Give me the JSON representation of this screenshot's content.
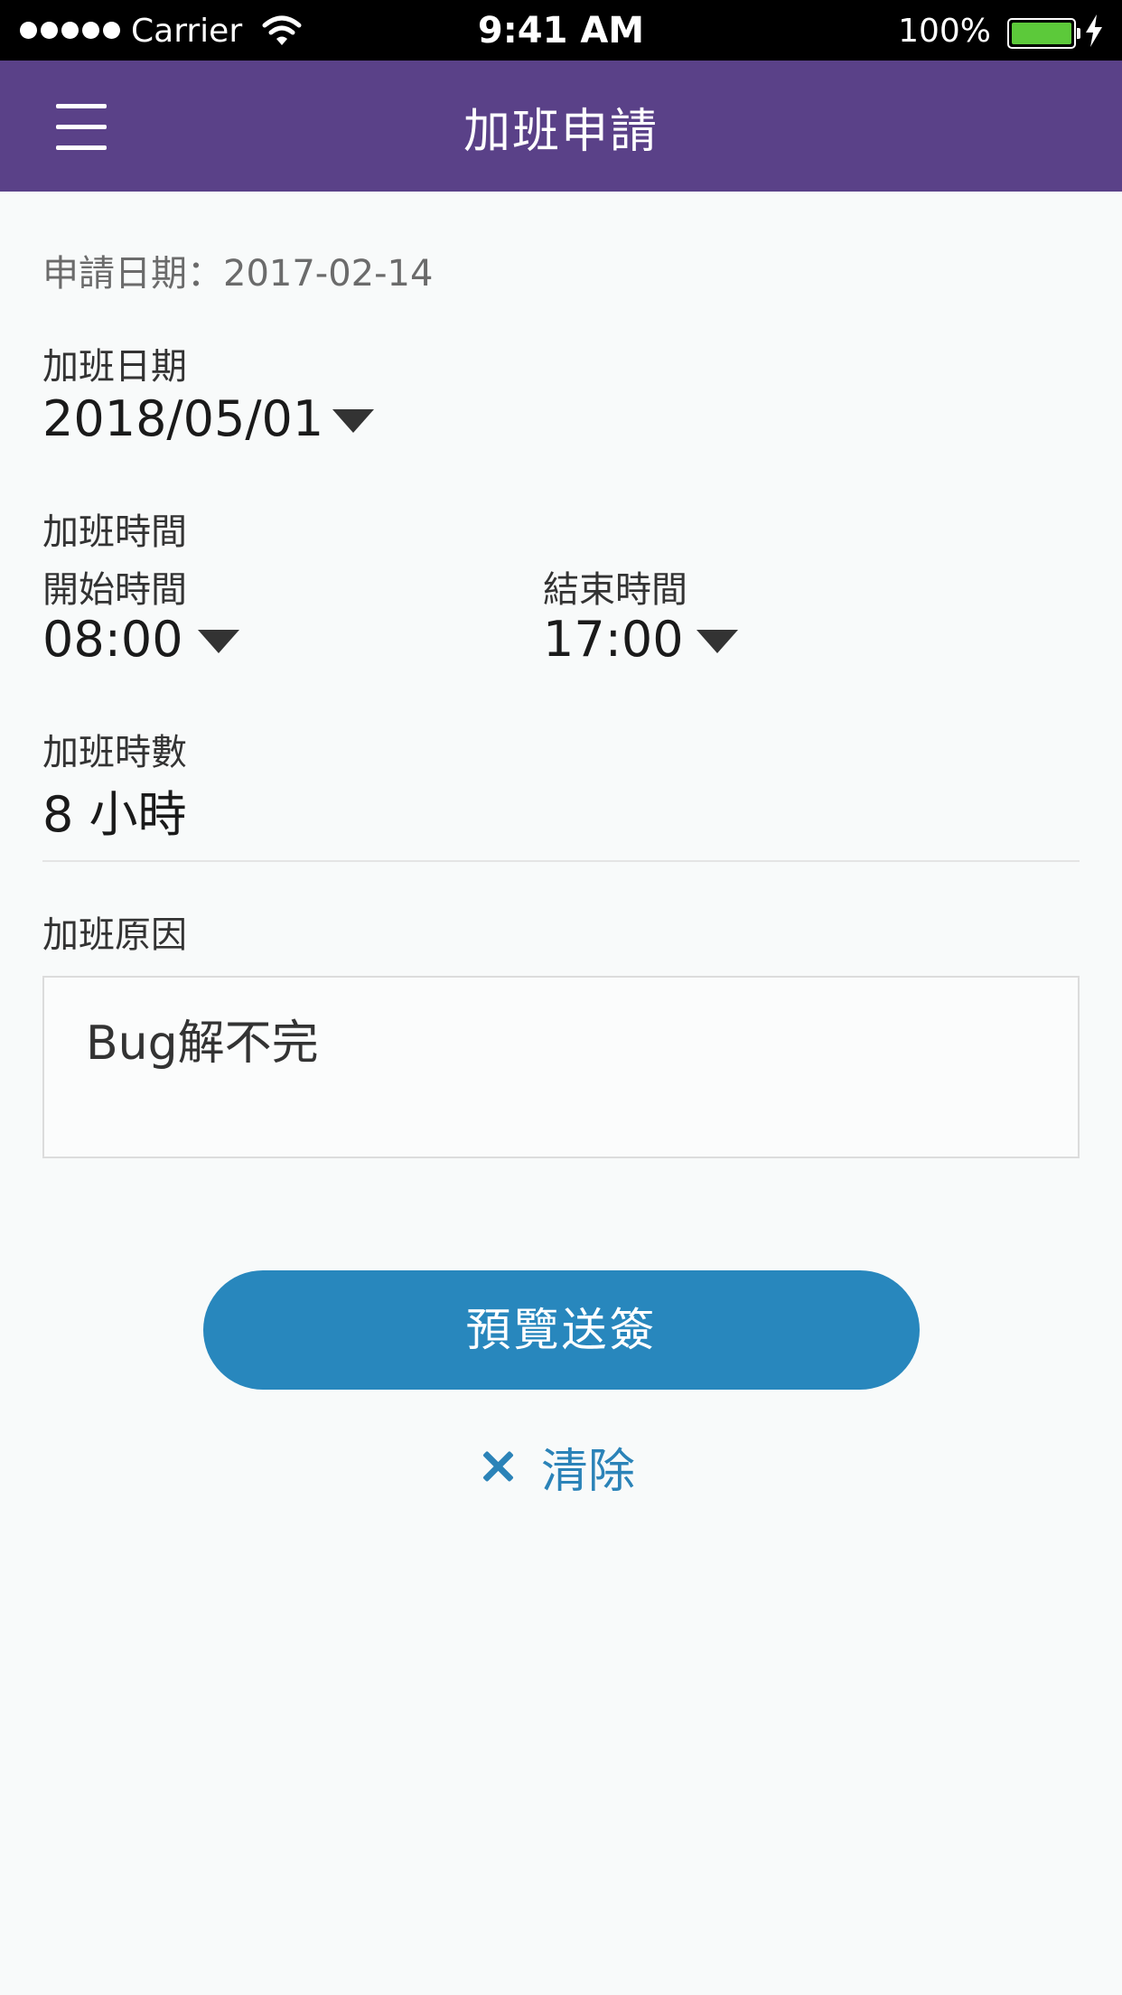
{
  "status_bar": {
    "carrier": "Carrier",
    "time": "9:41 AM",
    "battery": "100%",
    "battery_level": 1.0,
    "battery_color": "#5cc93a"
  },
  "nav": {
    "title": "加班申請",
    "menu_icon": "hamburger-menu-icon",
    "background": "#5a4188"
  },
  "form": {
    "apply_date_text": "申請日期：2017-02-14",
    "overtime_date": {
      "label": "加班日期",
      "value": "2018/05/01"
    },
    "overtime_time_label": "加班時間",
    "start_time": {
      "label": "開始時間",
      "value": "08:00"
    },
    "end_time": {
      "label": "結束時間",
      "value": "17:00"
    },
    "hours": {
      "label": "加班時數",
      "value": "8 小時"
    },
    "reason": {
      "label": "加班原因",
      "value": "Bug解不完"
    }
  },
  "actions": {
    "submit_label": "預覽送簽",
    "submit_color": "#2887bd",
    "clear_label": "清除",
    "clear_icon": "close-icon"
  }
}
